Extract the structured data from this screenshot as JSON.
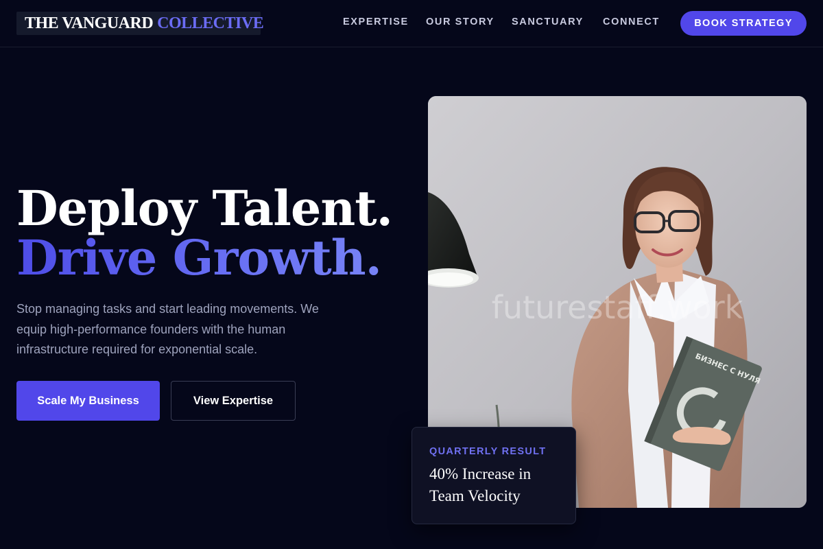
{
  "brand": {
    "name_part1": "THE VANGUARD",
    "name_part2": "COLLECTIVE",
    "accent_color": "#5147ea"
  },
  "nav": {
    "links": [
      "EXPERTISE",
      "OUR STORY",
      "SANCTUARY",
      "CONNECT"
    ],
    "cta": "BOOK STRATEGY"
  },
  "hero": {
    "headline_line1": "Deploy Talent.",
    "headline_line2": "Drive Growth.",
    "lead": "Stop managing tasks and start leading movements. We equip high-performance founders with the human infrastructure required for exponential scale.",
    "primary_button": "Scale My Business",
    "secondary_button": "View Expertise"
  },
  "photo": {
    "watermark": "futurestaff.work",
    "book_title": "БИЗНЕС С НУЛЯ"
  },
  "result_card": {
    "label": "QUARTERLY RESULT",
    "value": "40% Increase in Team Velocity"
  }
}
